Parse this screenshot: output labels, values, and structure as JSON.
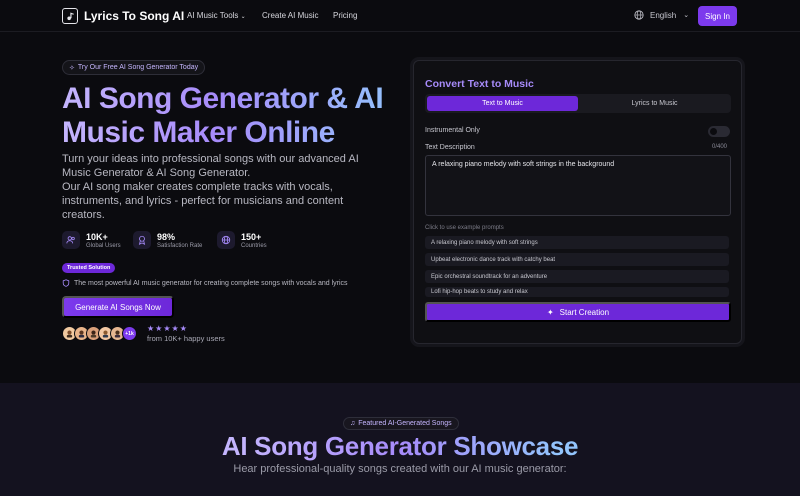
{
  "nav": {
    "logo_text": "Lyrics To Song AI",
    "links": [
      "AI Music Tools",
      "Create AI Music",
      "Pricing"
    ],
    "language": "English",
    "signin_label": "Sign In"
  },
  "hero": {
    "pill": "Try Our Free AI Song Generator Today",
    "title": "AI Song Generator & AI Music Maker Online",
    "subtitle_1": "Turn your ideas into professional songs with our advanced AI Music Generator & AI Song Generator.",
    "subtitle_2": "Our AI song maker creates complete tracks with vocals, instruments, and lyrics - perfect for musicians and content creators.",
    "stats": [
      {
        "value": "10K+",
        "label": "Global Users",
        "icon": "users-icon"
      },
      {
        "value": "98%",
        "label": "Satisfaction Rate",
        "icon": "award-icon"
      },
      {
        "value": "150+",
        "label": "Countries",
        "icon": "globe-icon"
      }
    ],
    "trusted_badge": "Trusted Solution",
    "trust_line": "The most powerful AI music generator for creating complete songs with vocals and lyrics",
    "cta_label": "Generate AI Songs Now",
    "avatar_more": "+1k",
    "stars": "★★★★★",
    "happy_users": "from 10K+ happy users"
  },
  "card": {
    "title": "Convert Text to Music",
    "tab_active": "Text to Music",
    "tab_idle": "Lyrics to Music",
    "instrumental_label": "Instrumental Only",
    "instrumental_on": false,
    "description_label": "Text Description",
    "counter": "0/400",
    "description_value": "A relaxing piano melody with soft strings in the background",
    "examples_label": "Click to use example prompts",
    "examples": [
      "A relaxing piano melody with soft strings",
      "Upbeat electronic dance track with catchy beat",
      "Epic orchestral soundtrack for an adventure",
      "Lofi hip-hop beats to study and relax"
    ],
    "start_label": "Start Creation"
  },
  "showcase": {
    "pill": "Featured AI-Generated Songs",
    "title": "AI Song Generator Showcase",
    "subtitle": "Hear professional-quality songs created with our AI music generator:"
  },
  "colors": {
    "accent": "#7c3aed",
    "accent_light": "#a78bfa",
    "background": "#0b0b0f"
  }
}
